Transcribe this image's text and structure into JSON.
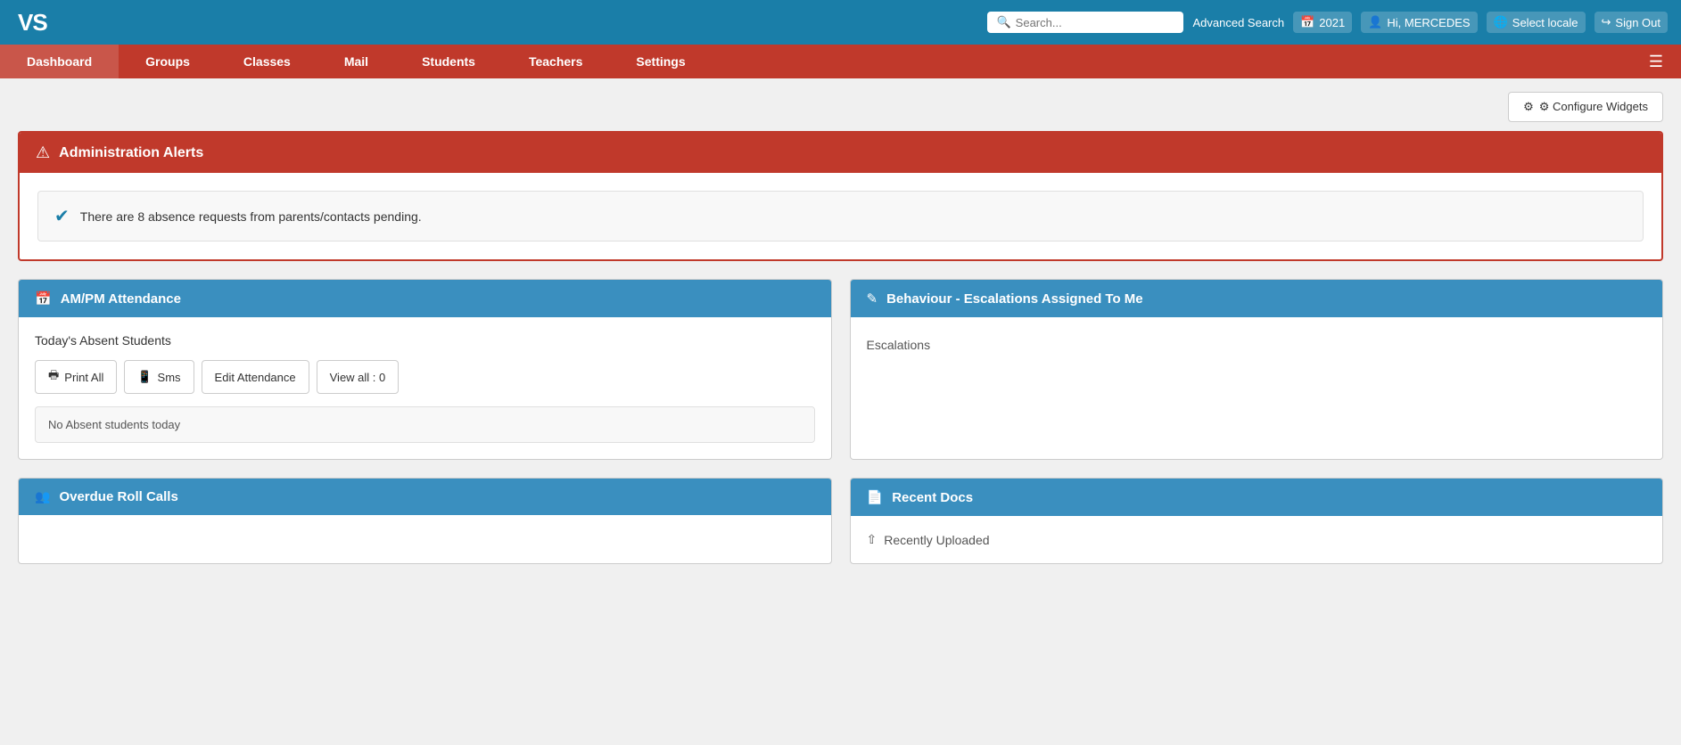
{
  "logo": {
    "text": "VS"
  },
  "header": {
    "search_placeholder": "Search...",
    "advanced_search": "Advanced Search",
    "year": "2021",
    "user_greeting": "Hi, MERCEDES",
    "select_locale": "Select locale",
    "sign_out": "Sign Out"
  },
  "nav": {
    "items": [
      {
        "label": "Dashboard",
        "active": true
      },
      {
        "label": "Groups"
      },
      {
        "label": "Classes"
      },
      {
        "label": "Mail"
      },
      {
        "label": "Students"
      },
      {
        "label": "Teachers"
      },
      {
        "label": "Settings"
      }
    ]
  },
  "configure_widgets_btn": "⚙ Configure Widgets",
  "admin_alerts": {
    "title": "Administration Alerts",
    "alert_message": "There are 8 absence requests from parents/contacts pending."
  },
  "attendance_widget": {
    "title": "AM/PM Attendance",
    "today_label": "Today's Absent Students",
    "print_all": "Print All",
    "sms": "Sms",
    "edit_attendance": "Edit Attendance",
    "view_all": "View all : 0",
    "no_absent": "No Absent students today"
  },
  "behaviour_widget": {
    "title": "Behaviour - Escalations Assigned To Me",
    "escalations_label": "Escalations"
  },
  "recent_docs_widget": {
    "title": "Recent Docs",
    "recently_uploaded": "Recently Uploaded"
  },
  "overdue_widget": {
    "title": "Overdue Roll Calls"
  }
}
